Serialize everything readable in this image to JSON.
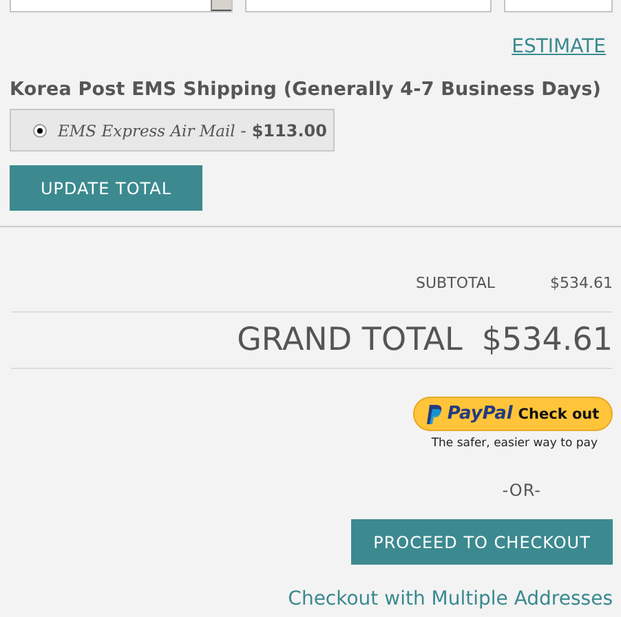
{
  "address_fields": [
    {
      "kind": "select"
    },
    {
      "kind": "input"
    },
    {
      "kind": "input"
    }
  ],
  "estimate_link": "ESTIMATE",
  "shipping": {
    "carrier": "Korea Post EMS Shipping (Generally 4-7 Business Days)",
    "options": [
      {
        "label": "*EMS Express Air Mail* - **$113.00**",
        "selected": true
      }
    ]
  },
  "update_button": "UPDATE TOTAL",
  "totals": {
    "subtotal_label": "SUBTOTAL",
    "subtotal": "$534.61",
    "grand_total_label": "GRAND TOTAL",
    "grand_total": "$534.61"
  },
  "paypal": {
    "logo": "PayPal",
    "action": "Check out",
    "tagline": "The safer, easier way to pay"
  },
  "or_text": "-OR-",
  "checkout_button": "PROCEED TO CHECKOUT",
  "multi_address_link": "Checkout with Multiple Addresses"
}
